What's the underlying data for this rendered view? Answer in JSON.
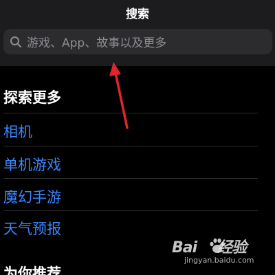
{
  "header": {
    "title": "搜索"
  },
  "search": {
    "placeholder": "游戏、App、故事以及更多",
    "icon": "search-icon"
  },
  "explore": {
    "title": "探索更多",
    "items": [
      {
        "label": "相机"
      },
      {
        "label": "单机游戏"
      },
      {
        "label": "魔幻手游"
      },
      {
        "label": "天气预报"
      }
    ]
  },
  "recommend": {
    "title": "为你推荐"
  },
  "watermark": {
    "brand_left": "Bai",
    "brand_right": "经验",
    "url": "jingyan.baidu.com"
  },
  "colors": {
    "background": "#000000",
    "header_bg": "#1c1c1e",
    "search_bg": "#2c2c2e",
    "link": "#3a86ff",
    "annotation_arrow": "#e0262b"
  }
}
